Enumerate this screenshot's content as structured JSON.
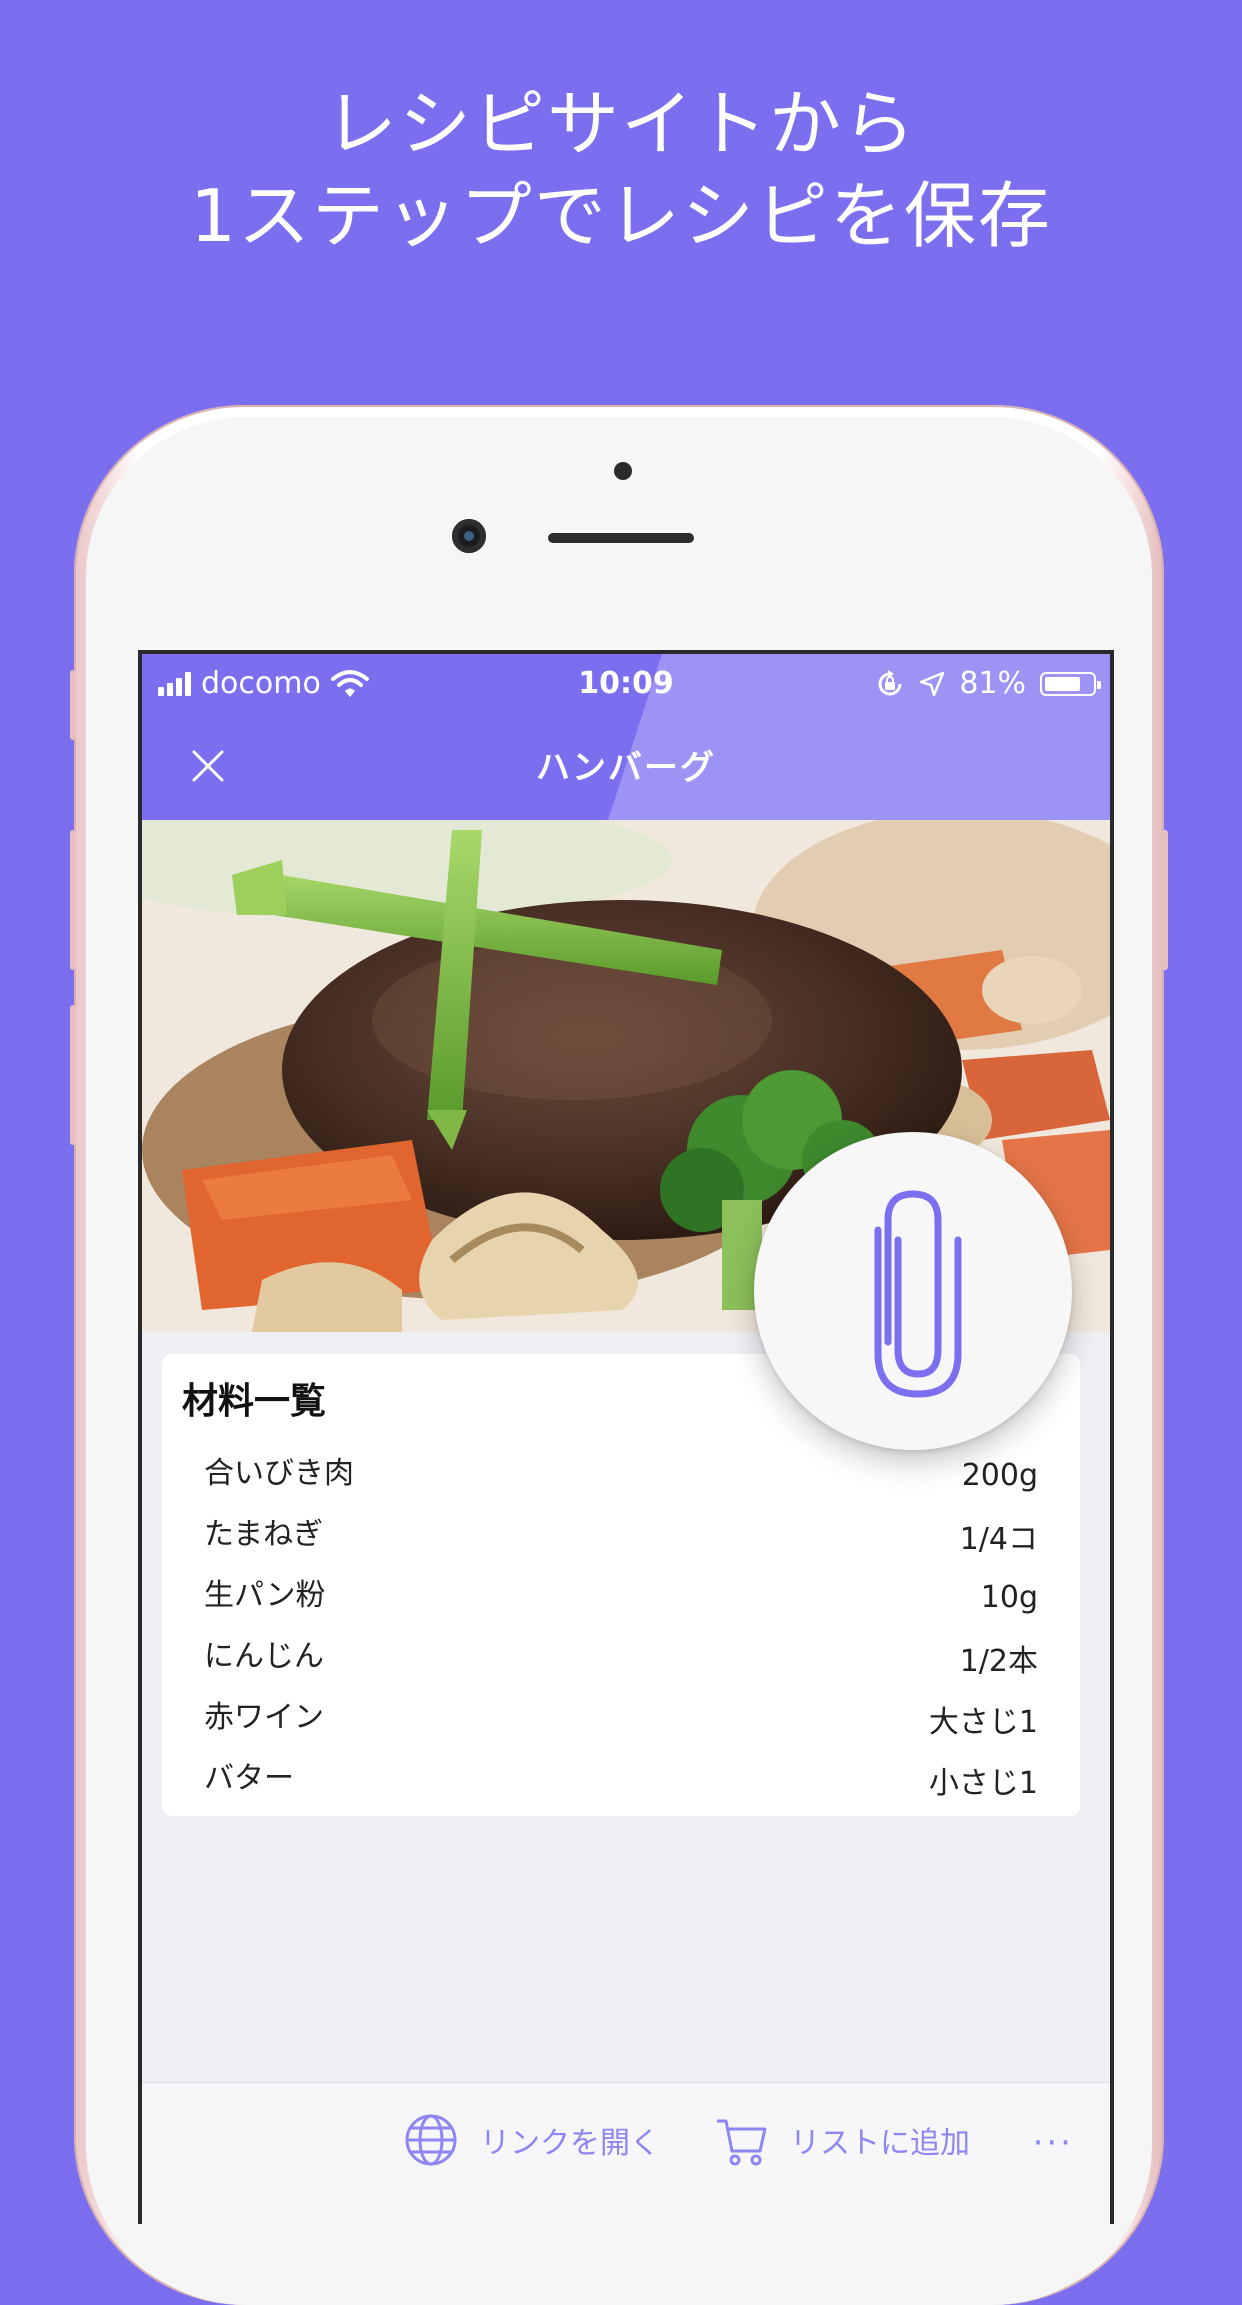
{
  "headline": {
    "line1": "レシピサイトから",
    "line2": "1ステップでレシピを保存"
  },
  "status_bar": {
    "carrier": "docomo",
    "time": "10:09",
    "battery": "81%",
    "battery_level": 0.81
  },
  "nav": {
    "title": "ハンバーグ"
  },
  "ingredients": {
    "title": "材料一覧",
    "items": [
      {
        "name": "合いびき肉",
        "amount": "200g"
      },
      {
        "name": "たまねぎ",
        "amount": "1/4コ"
      },
      {
        "name": "生パン粉",
        "amount": "10g"
      },
      {
        "name": "にんじん",
        "amount": "1/2本"
      },
      {
        "name": "赤ワイン",
        "amount": "大さじ1"
      },
      {
        "name": "バター",
        "amount": "小さじ1"
      }
    ]
  },
  "toolbar": {
    "open_link": "リンクを開く",
    "add_to_list": "リストに追加",
    "more": "···"
  },
  "colors": {
    "brand": "#7b6ff0",
    "accent_light": "#8e86f2"
  },
  "icons": {
    "close": "close-icon",
    "clip": "paperclip-icon",
    "globe": "globe-icon",
    "cart": "cart-icon"
  }
}
